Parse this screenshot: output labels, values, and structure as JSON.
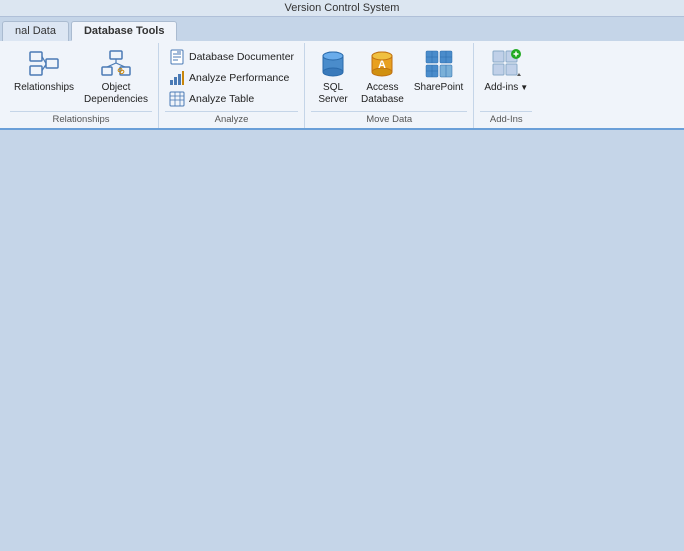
{
  "titleBar": {
    "text": "Version Control System"
  },
  "tabs": [
    {
      "id": "external-data",
      "label": "nal Data",
      "active": false
    },
    {
      "id": "database-tools",
      "label": "Database Tools",
      "active": true
    }
  ],
  "ribbon": {
    "groups": [
      {
        "id": "relationships",
        "label": "Relationships",
        "buttons": [
          {
            "id": "relationships-btn",
            "label": "Relationships",
            "type": "large"
          },
          {
            "id": "object-dependencies-btn",
            "label": "Object\nDependencies",
            "type": "large"
          }
        ]
      },
      {
        "id": "analyze",
        "label": "Analyze",
        "buttons": [
          {
            "id": "db-documenter-btn",
            "label": "Database Documenter",
            "type": "small"
          },
          {
            "id": "analyze-performance-btn",
            "label": "Analyze Performance",
            "type": "small"
          },
          {
            "id": "analyze-table-btn",
            "label": "Analyze Table",
            "type": "small"
          }
        ]
      },
      {
        "id": "move-data",
        "label": "Move Data",
        "buttons": [
          {
            "id": "sql-server-btn",
            "label": "SQL\nServer",
            "type": "large"
          },
          {
            "id": "access-database-btn",
            "label": "Access\nDatabase",
            "type": "large"
          },
          {
            "id": "sharepoint-btn",
            "label": "SharePoint",
            "type": "large"
          }
        ]
      },
      {
        "id": "add-ins",
        "label": "Add-Ins",
        "buttons": [
          {
            "id": "add-ins-btn",
            "label": "Add-ins",
            "type": "large"
          }
        ]
      }
    ]
  },
  "colors": {
    "accent": "#6a9fd8",
    "ribbon_bg": "#f0f4fa",
    "tab_active": "#f0f4fa",
    "content_bg": "#c5d5e8"
  }
}
